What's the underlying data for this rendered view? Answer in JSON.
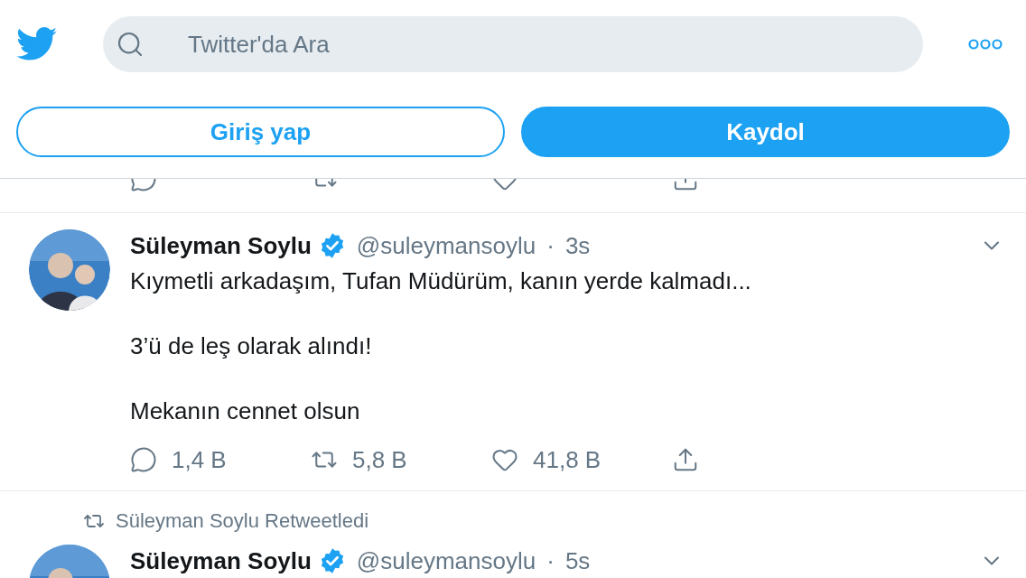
{
  "search": {
    "placeholder": "Twitter'da Ara"
  },
  "buttons": [
    {
      "label": "Giriş yap",
      "kind": "outline"
    },
    {
      "label": "Kaydol",
      "kind": "filled"
    }
  ],
  "tweets": [
    {
      "name": "Süleyman Soylu",
      "verified": true,
      "handle": "@suleymansoylu",
      "separator": "·",
      "time": "3s",
      "paragraphs": [
        "Kıymetli arkadaşım, Tufan Müdürüm, kanın yerde kalmadı...",
        "3’ü de leş olarak alındı!",
        "Mekanın cennet olsun"
      ],
      "actions": {
        "reply": "1,4 B",
        "retweet": "5,8 B",
        "like": "41,8 B"
      }
    },
    {
      "retweet_label": "Süleyman Soylu Retweetledi",
      "name": "Süleyman Soylu",
      "verified": true,
      "handle": "@suleymansoylu",
      "separator": "·",
      "time": "5s"
    }
  ]
}
